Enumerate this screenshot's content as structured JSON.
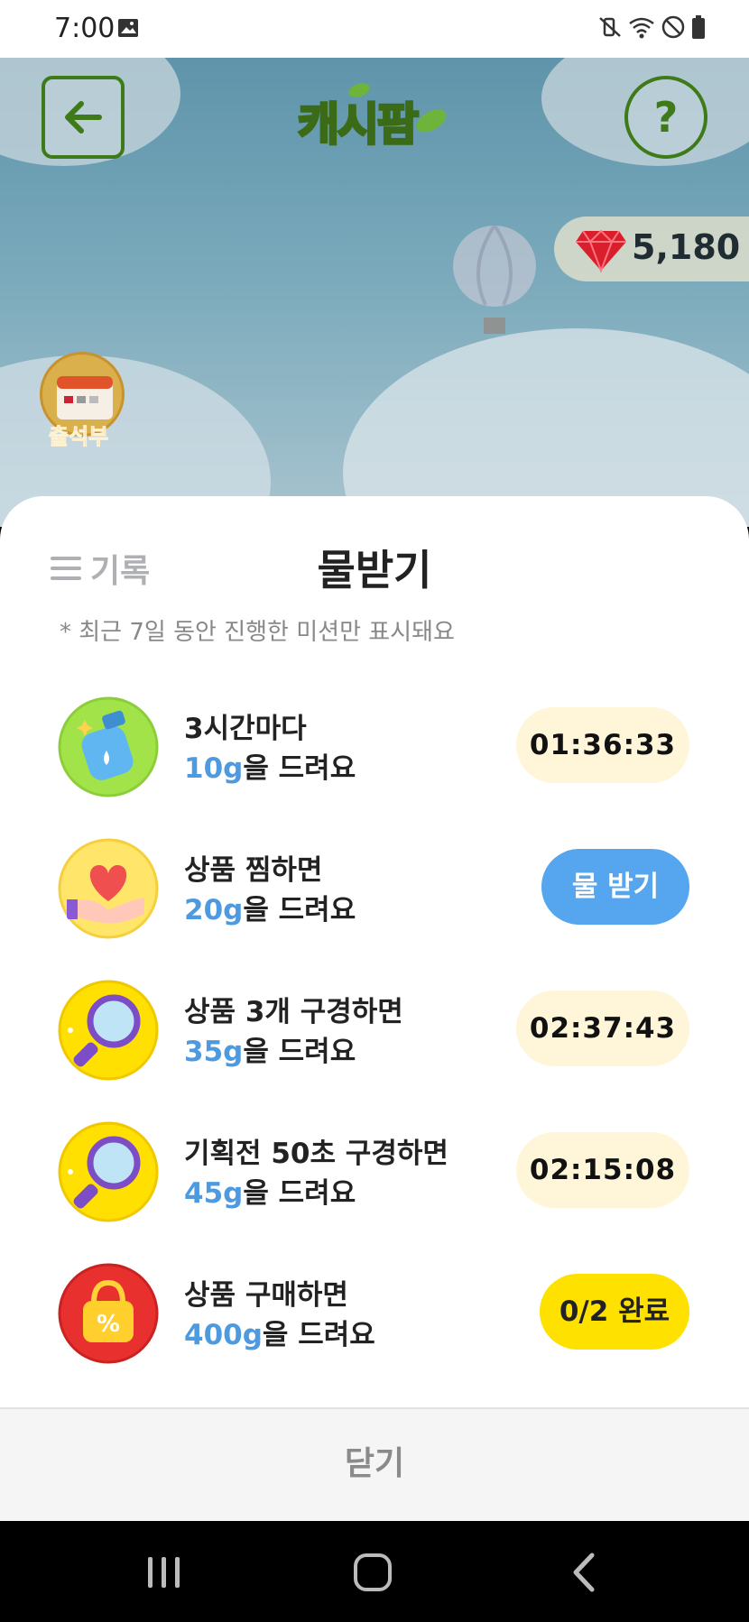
{
  "status_bar": {
    "time": "7:00",
    "icons": [
      "image-icon",
      "vibrate-mute-icon",
      "wifi-icon",
      "do-not-disturb-icon",
      "battery-icon"
    ]
  },
  "header": {
    "logo_text": "캐시팜",
    "back_icon": "arrow-left-icon",
    "help_label": "?"
  },
  "gems": {
    "icon": "ruby-gem-icon",
    "value": "5,180"
  },
  "side_menu": {
    "attendance_label": "출석부"
  },
  "sheet": {
    "history_label": "기록",
    "title": "물받기",
    "notice": "* 최근 7일 동안 진행한 미션만 표시돼요",
    "missions": [
      {
        "line1": "3시간마다",
        "amount": "10g",
        "suffix": "을 드려요",
        "button": "01:36:33",
        "state": "timer",
        "icon": "water-bottle-icon"
      },
      {
        "line1": "상품 찜하면",
        "amount": "20g",
        "suffix": "을 드려요",
        "button": "물 받기",
        "state": "action",
        "icon": "heart-hand-icon"
      },
      {
        "line1": "상품 3개 구경하면",
        "amount": "35g",
        "suffix": "을 드려요",
        "button": "02:37:43",
        "state": "timer",
        "icon": "magnifier-icon"
      },
      {
        "line1": "기획전 50초 구경하면",
        "amount": "45g",
        "suffix": "을 드려요",
        "button": "02:15:08",
        "state": "timer",
        "icon": "magnifier-icon"
      },
      {
        "line1": "상품 구매하면",
        "amount": "400g",
        "suffix": "을 드려요",
        "button": "0/2 완료",
        "state": "done",
        "icon": "shopping-bag-percent-icon",
        "bag_symbol": "%"
      }
    ],
    "close_label": "닫기"
  },
  "colors": {
    "accent_blue": "#4d9ae0",
    "timer_bg": "#fff6d9",
    "action_bg": "#55a6ee",
    "done_bg": "#ffe100",
    "header_green": "#3e7a18"
  }
}
